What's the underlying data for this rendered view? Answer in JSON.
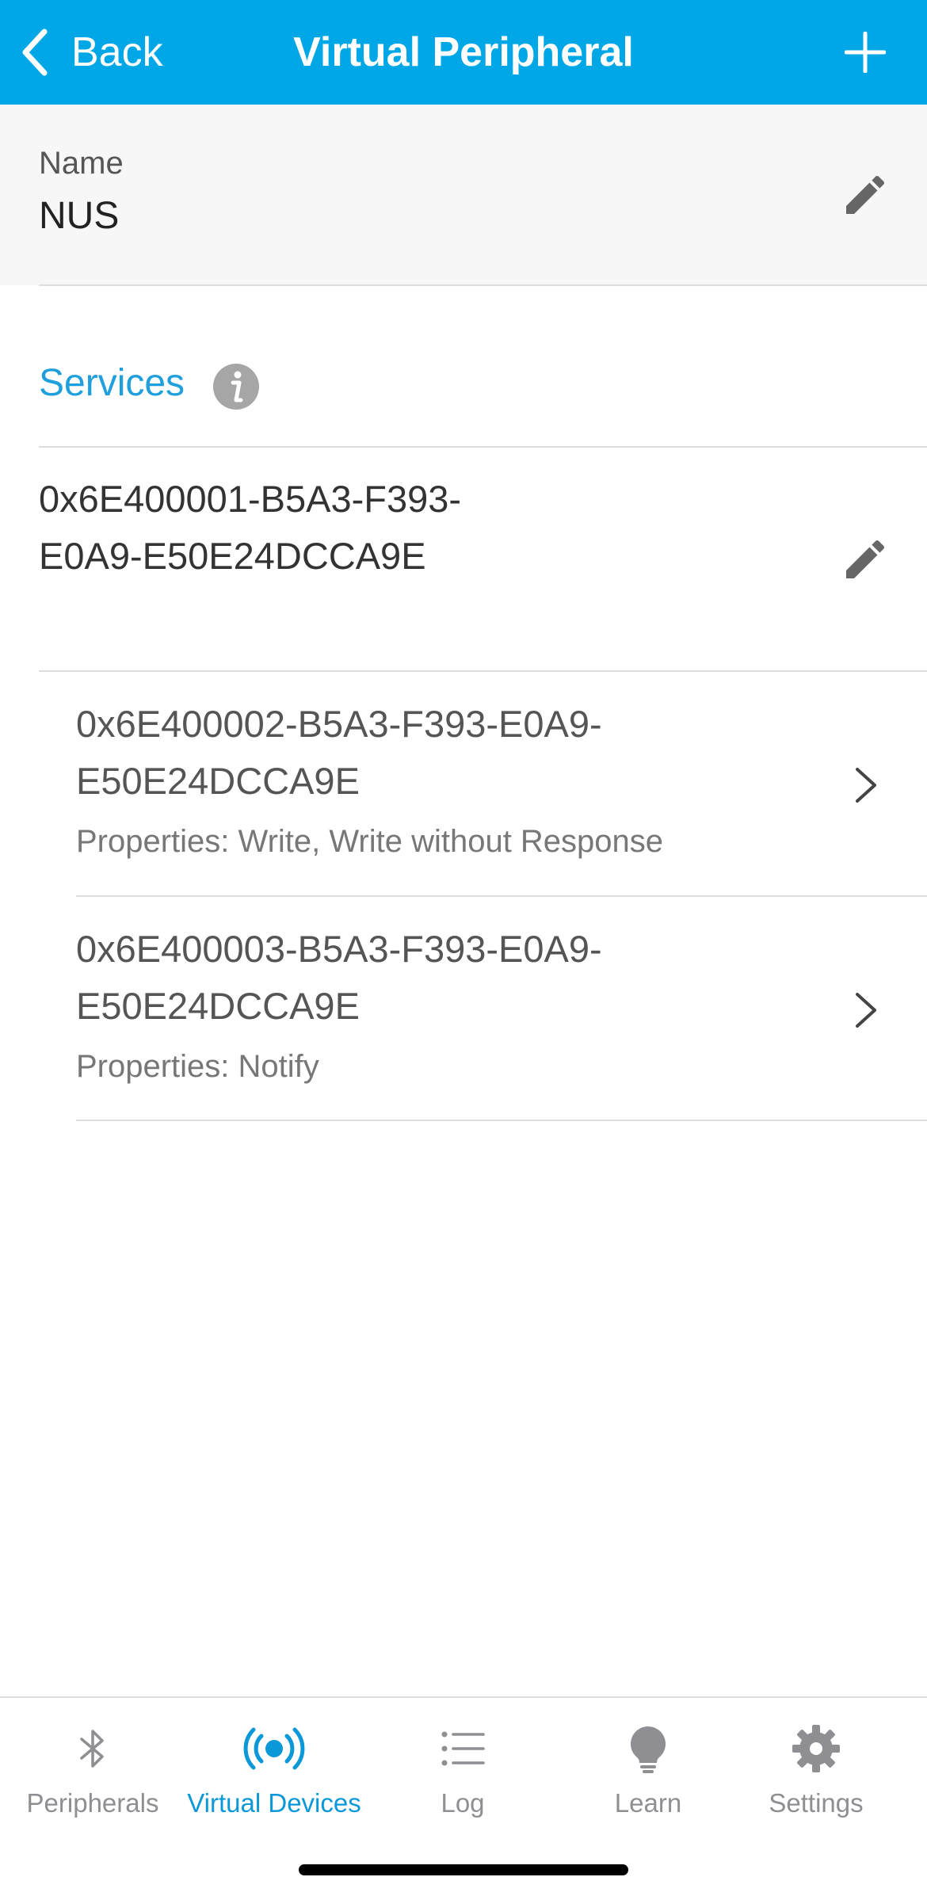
{
  "nav": {
    "back_label": "Back",
    "title": "Virtual Peripheral",
    "add_icon": "plus-icon",
    "back_icon": "chevron-left-icon"
  },
  "name_section": {
    "label": "Name",
    "value": "NUS",
    "edit_icon": "pencil-icon"
  },
  "services": {
    "title": "Services",
    "info_icon": "info-icon",
    "items": [
      {
        "uuid": "0x6E400001-B5A3-F393-E0A9-E50E24DCCA9E",
        "characteristics": [
          {
            "uuid": "0x6E400002-B5A3-F393-E0A9-E50E24DCCA9E",
            "properties": "Properties: Write, Write without Response"
          },
          {
            "uuid": "0x6E400003-B5A3-F393-E0A9-E50E24DCCA9E",
            "properties": "Properties: Notify"
          }
        ]
      }
    ]
  },
  "tabbar": {
    "active": "Virtual Devices",
    "tabs": [
      {
        "label": "Peripherals",
        "icon": "bluetooth-icon"
      },
      {
        "label": "Virtual Devices",
        "icon": "broadcast-icon"
      },
      {
        "label": "Log",
        "icon": "list-icon"
      },
      {
        "label": "Learn",
        "icon": "lightbulb-icon"
      },
      {
        "label": "Settings",
        "icon": "gear-icon"
      }
    ]
  },
  "colors": {
    "nav_background": "#00A7E6",
    "accent": "#1FA0DC",
    "active_tab": "#0A98D9",
    "inactive_tab": "#8E8E93",
    "name_section_background": "#F7F7F7"
  }
}
